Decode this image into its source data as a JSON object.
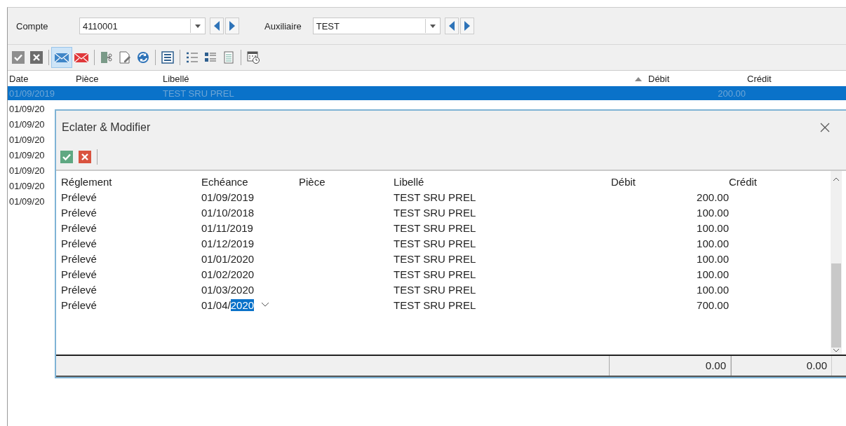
{
  "filter": {
    "account_label": "Compte",
    "account_value": "4110001",
    "auxiliary_label": "Auxiliaire",
    "auxiliary_value": "TEST"
  },
  "toolbar": [
    [
      {
        "kind": "check",
        "disabled": true,
        "pressed": false
      },
      {
        "kind": "cross",
        "disabled": true,
        "pressed": false
      }
    ],
    [
      {
        "kind": "mail",
        "disabled": false,
        "pressed": true
      },
      {
        "kind": "mail-red",
        "disabled": false,
        "pressed": false
      }
    ],
    [
      {
        "kind": "split",
        "disabled": false,
        "pressed": false
      },
      {
        "kind": "edit",
        "disabled": false,
        "pressed": false
      },
      {
        "kind": "refresh",
        "disabled": false,
        "pressed": false
      }
    ],
    [
      {
        "kind": "list-box",
        "disabled": false,
        "pressed": false
      }
    ],
    [
      {
        "kind": "bullets",
        "disabled": false,
        "pressed": false
      },
      {
        "kind": "details",
        "disabled": false,
        "pressed": false
      },
      {
        "kind": "page",
        "disabled": false,
        "pressed": false
      }
    ],
    [
      {
        "kind": "calendar",
        "disabled": false,
        "pressed": false
      }
    ]
  ],
  "table": {
    "columns": [
      {
        "label": "Date",
        "sorted_ascending": false
      },
      {
        "label": "Pièce",
        "sorted_ascending": false
      },
      {
        "label": "Libellé",
        "sorted_ascending": false
      },
      {
        "label": "Débit",
        "sorted_ascending": true
      },
      {
        "label": "Crédit",
        "sorted_ascending": false
      }
    ],
    "rows": [
      {
        "date": "01/09/2019",
        "libelle": "TEST SRU PREL",
        "debit": "200.00",
        "selected": true
      },
      {
        "date": "01/09/20",
        "selected": false
      },
      {
        "date": "01/09/20",
        "selected": false
      },
      {
        "date": "01/09/20",
        "selected": false
      },
      {
        "date": "01/09/20",
        "selected": false
      },
      {
        "date": "01/09/20",
        "selected": false
      },
      {
        "date": "01/09/20",
        "selected": false
      },
      {
        "date": "01/09/20",
        "selected": false
      }
    ]
  },
  "dialog": {
    "title": "Eclater & Modifier",
    "toolbar": [
      {
        "kind": "check",
        "disabled": false,
        "pressed": false
      },
      {
        "kind": "cross",
        "disabled": false,
        "pressed": false
      }
    ],
    "columns": [
      "Réglement",
      "Echéance",
      "Pièce",
      "Libellé",
      "Débit",
      "Crédit"
    ],
    "rows": [
      {
        "reglement": "Prélevé",
        "echeance": "01/09/2019",
        "libelle": "TEST SRU PREL",
        "debit": "200.00",
        "editing": false
      },
      {
        "reglement": "Prélevé",
        "echeance": "01/10/2018",
        "libelle": "TEST SRU PREL",
        "debit": "100.00",
        "editing": false
      },
      {
        "reglement": "Prélevé",
        "echeance": "01/11/2019",
        "libelle": "TEST SRU PREL",
        "debit": "100.00",
        "editing": false
      },
      {
        "reglement": "Prélevé",
        "echeance": "01/12/2019",
        "libelle": "TEST SRU PREL",
        "debit": "100.00",
        "editing": false
      },
      {
        "reglement": "Prélevé",
        "echeance": "01/01/2020",
        "libelle": "TEST SRU PREL",
        "debit": "100.00",
        "editing": false
      },
      {
        "reglement": "Prélevé",
        "echeance": "01/02/2020",
        "libelle": "TEST SRU PREL",
        "debit": "100.00",
        "editing": false
      },
      {
        "reglement": "Prélevé",
        "echeance": "01/03/2020",
        "libelle": "TEST SRU PREL",
        "debit": "100.00",
        "editing": false
      },
      {
        "reglement": "Prélevé",
        "echeance": "01/04/",
        "echeance_selected": "2020",
        "libelle": "TEST SRU PREL",
        "debit": "700.00",
        "editing": true
      }
    ],
    "totals": {
      "debit": "0.00",
      "credit": "0.00"
    }
  }
}
